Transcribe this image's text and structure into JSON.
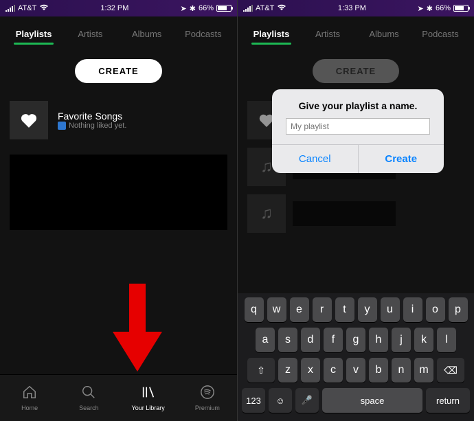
{
  "left": {
    "status": {
      "carrier": "AT&T",
      "time": "1:32 PM",
      "battery": "66%"
    },
    "tabs": [
      "Playlists",
      "Artists",
      "Albums",
      "Podcasts"
    ],
    "activeTab": 0,
    "create_label": "CREATE",
    "fav": {
      "title": "Favorite Songs",
      "sub": "Nothing liked yet."
    },
    "nav": [
      {
        "label": "Home"
      },
      {
        "label": "Search"
      },
      {
        "label": "Your Library"
      },
      {
        "label": "Premium"
      }
    ],
    "nav_active": 2
  },
  "right": {
    "status": {
      "carrier": "AT&T",
      "time": "1:33 PM",
      "battery": "66%"
    },
    "tabs": [
      "Playlists",
      "Artists",
      "Albums",
      "Podcasts"
    ],
    "activeTab": 0,
    "create_label": "CREATE",
    "dialog": {
      "title": "Give your playlist a name.",
      "placeholder": "My playlist",
      "cancel": "Cancel",
      "create": "Create"
    },
    "keyboard": {
      "r1": [
        "q",
        "w",
        "e",
        "r",
        "t",
        "y",
        "u",
        "i",
        "o",
        "p"
      ],
      "r2": [
        "a",
        "s",
        "d",
        "f",
        "g",
        "h",
        "j",
        "k",
        "l"
      ],
      "r3": [
        "z",
        "x",
        "c",
        "v",
        "b",
        "n",
        "m"
      ],
      "shift": "⇧",
      "backspace": "⌫",
      "num": "123",
      "emoji": "☺",
      "mic": "🎤",
      "space": "space",
      "return": "return"
    }
  }
}
